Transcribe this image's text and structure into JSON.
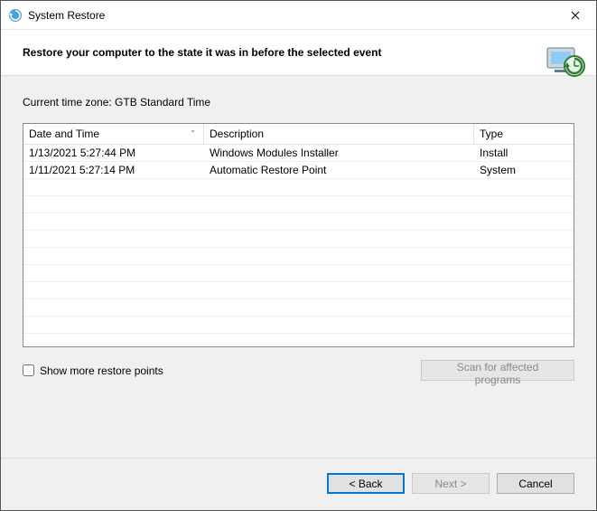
{
  "window": {
    "title": "System Restore"
  },
  "header": {
    "heading": "Restore your computer to the state it was in before the selected event"
  },
  "content": {
    "timezone_label": "Current time zone: GTB Standard Time",
    "columns": {
      "date": "Date and Time",
      "description": "Description",
      "type": "Type",
      "sort_indicator": "⌄"
    },
    "rows": [
      {
        "date": "1/13/2021 5:27:44 PM",
        "description": "Windows Modules Installer",
        "type": "Install"
      },
      {
        "date": "1/11/2021 5:27:14 PM",
        "description": "Automatic Restore Point",
        "type": "System"
      }
    ],
    "show_more_label": "Show more restore points",
    "show_more_checked": false,
    "scan_button": "Scan for affected programs",
    "scan_enabled": false
  },
  "footer": {
    "back": "< Back",
    "next": "Next >",
    "next_enabled": false,
    "cancel": "Cancel"
  }
}
